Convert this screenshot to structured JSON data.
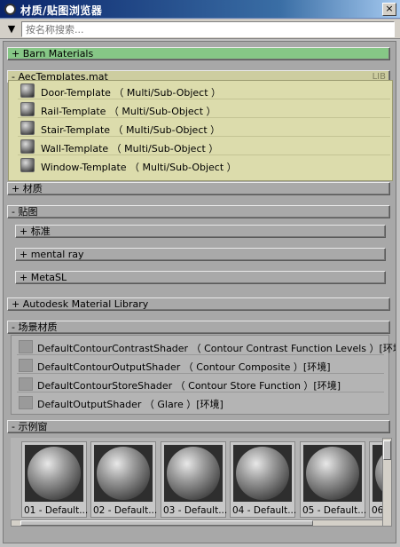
{
  "window": {
    "title": "材质/贴图浏览器",
    "close": "×"
  },
  "search": {
    "dropdown": "▼",
    "placeholder": "按名称搜索..."
  },
  "rollouts": {
    "barn": "+ Barn Materials",
    "aec": "- AecTemplates.mat",
    "aec_badge": "LIB",
    "caizhi": "+ 材质",
    "tietu": "- 贴图",
    "autodesk": "+ Autodesk Material Library",
    "scene": "- 场景材质",
    "samples": "- 示例窗"
  },
  "library_items": [
    "Door-Template （ Multi/Sub-Object ）",
    "Rail-Template （ Multi/Sub-Object ）",
    "Stair-Template （ Multi/Sub-Object ）",
    "Wall-Template （ Multi/Sub-Object ）",
    "Window-Template （ Multi/Sub-Object ）"
  ],
  "map_groups": [
    "+ 标准",
    "+ mental ray",
    "+ MetaSL"
  ],
  "scene_items": [
    "DefaultContourContrastShader （ Contour Contrast Function Levels ）[环境]",
    "DefaultContourOutputShader （ Contour Composite ）[环境]",
    "DefaultContourStoreShader （ Contour Store Function ）[环境]",
    "DefaultOutputShader （ Glare ）[环境]"
  ],
  "sample_slots": [
    "01 - Default...",
    "02 - Default...",
    "03 - Default...",
    "04 - Default...",
    "05 - Default...",
    "06"
  ]
}
